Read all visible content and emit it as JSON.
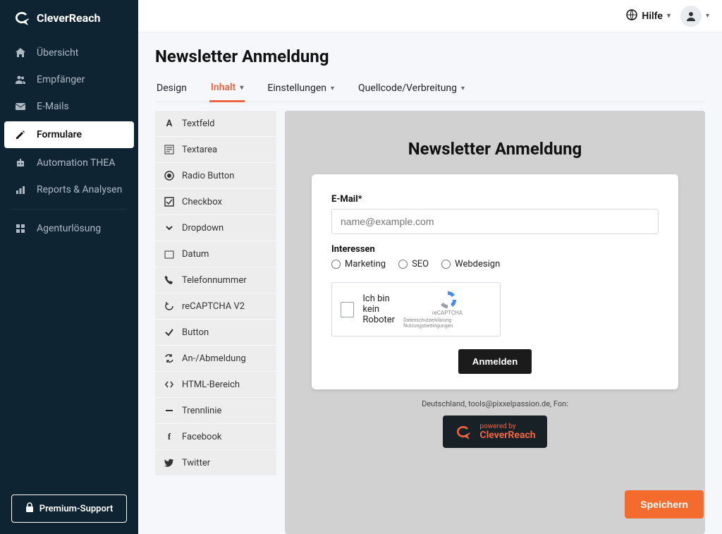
{
  "brand": {
    "name": "CleverReach"
  },
  "topbar": {
    "help": "Hilfe"
  },
  "sidebar": {
    "items": [
      {
        "label": "Übersicht"
      },
      {
        "label": "Empfänger"
      },
      {
        "label": "E-Mails"
      },
      {
        "label": "Formulare"
      },
      {
        "label": "Automation THEA"
      },
      {
        "label": "Reports & Analysen"
      },
      {
        "label": "Agenturlösung"
      }
    ],
    "premium": "Premium-Support"
  },
  "page": {
    "title": "Newsletter Anmeldung"
  },
  "tabs": [
    {
      "label": "Design"
    },
    {
      "label": "Inhalt"
    },
    {
      "label": "Einstellungen"
    },
    {
      "label": "Quellcode/Verbreitung"
    }
  ],
  "elements": [
    {
      "label": "Textfeld"
    },
    {
      "label": "Textarea"
    },
    {
      "label": "Radio Button"
    },
    {
      "label": "Checkbox"
    },
    {
      "label": "Dropdown"
    },
    {
      "label": "Datum"
    },
    {
      "label": "Telefonnummer"
    },
    {
      "label": "reCAPTCHA V2"
    },
    {
      "label": "Button"
    },
    {
      "label": "An-/Abmeldung"
    },
    {
      "label": "HTML-Bereich"
    },
    {
      "label": "Trennlinie"
    },
    {
      "label": "Facebook"
    },
    {
      "label": "Twitter"
    }
  ],
  "preview": {
    "heading": "Newsletter Anmeldung",
    "email_label": "E-Mail*",
    "email_placeholder": "name@example.com",
    "interests_label": "Interessen",
    "interests": [
      "Marketing",
      "SEO",
      "Webdesign"
    ],
    "captcha_text": "Ich bin kein Roboter",
    "captcha_brand": "reCAPTCHA",
    "captcha_terms": "Datenschutzerklärung · Nutzungsbedingungen",
    "submit": "Anmelden",
    "footer_text": "Deutschland, tools@pixxelpassion.de, Fon:",
    "powered_by": "powered by",
    "powered_brand": "CleverReach"
  },
  "actions": {
    "save": "Speichern"
  }
}
